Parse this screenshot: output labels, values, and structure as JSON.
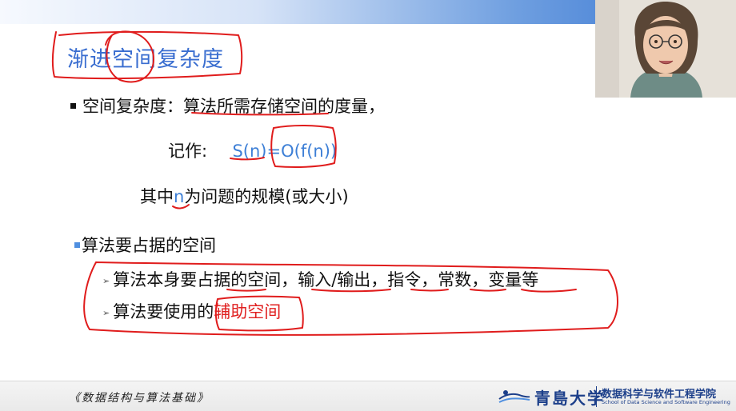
{
  "slide": {
    "title": "渐进空间复杂度",
    "b1_label": "空间复杂度：",
    "b1_def": "算法所需存储空间的度量，",
    "notation_label": "记作:",
    "notation_s": "S(n)",
    "notation_eq": "=",
    "notation_o": "O(f(n))",
    "where_pre": "其中",
    "where_n": "n",
    "where_post": "为问题的规模(或大小)",
    "b2": "算法要占据的空间",
    "sub1_pre": "算法本身要占据的空间，输入/输出，指令，常数，变量等",
    "sub2_pre": "算法要使用的",
    "sub2_red": "辅助空间"
  },
  "footer": {
    "course": "《数据结构与算法基础》",
    "university": "青島大学",
    "college": "数据科学与软件工程学院",
    "college_en": "School of Data Science and Software Engineering"
  },
  "colors": {
    "title": "#3a6ed0",
    "accent_blue": "#3d7fd6",
    "annotation_red": "#e02020",
    "brand": "#1c3f8a"
  }
}
